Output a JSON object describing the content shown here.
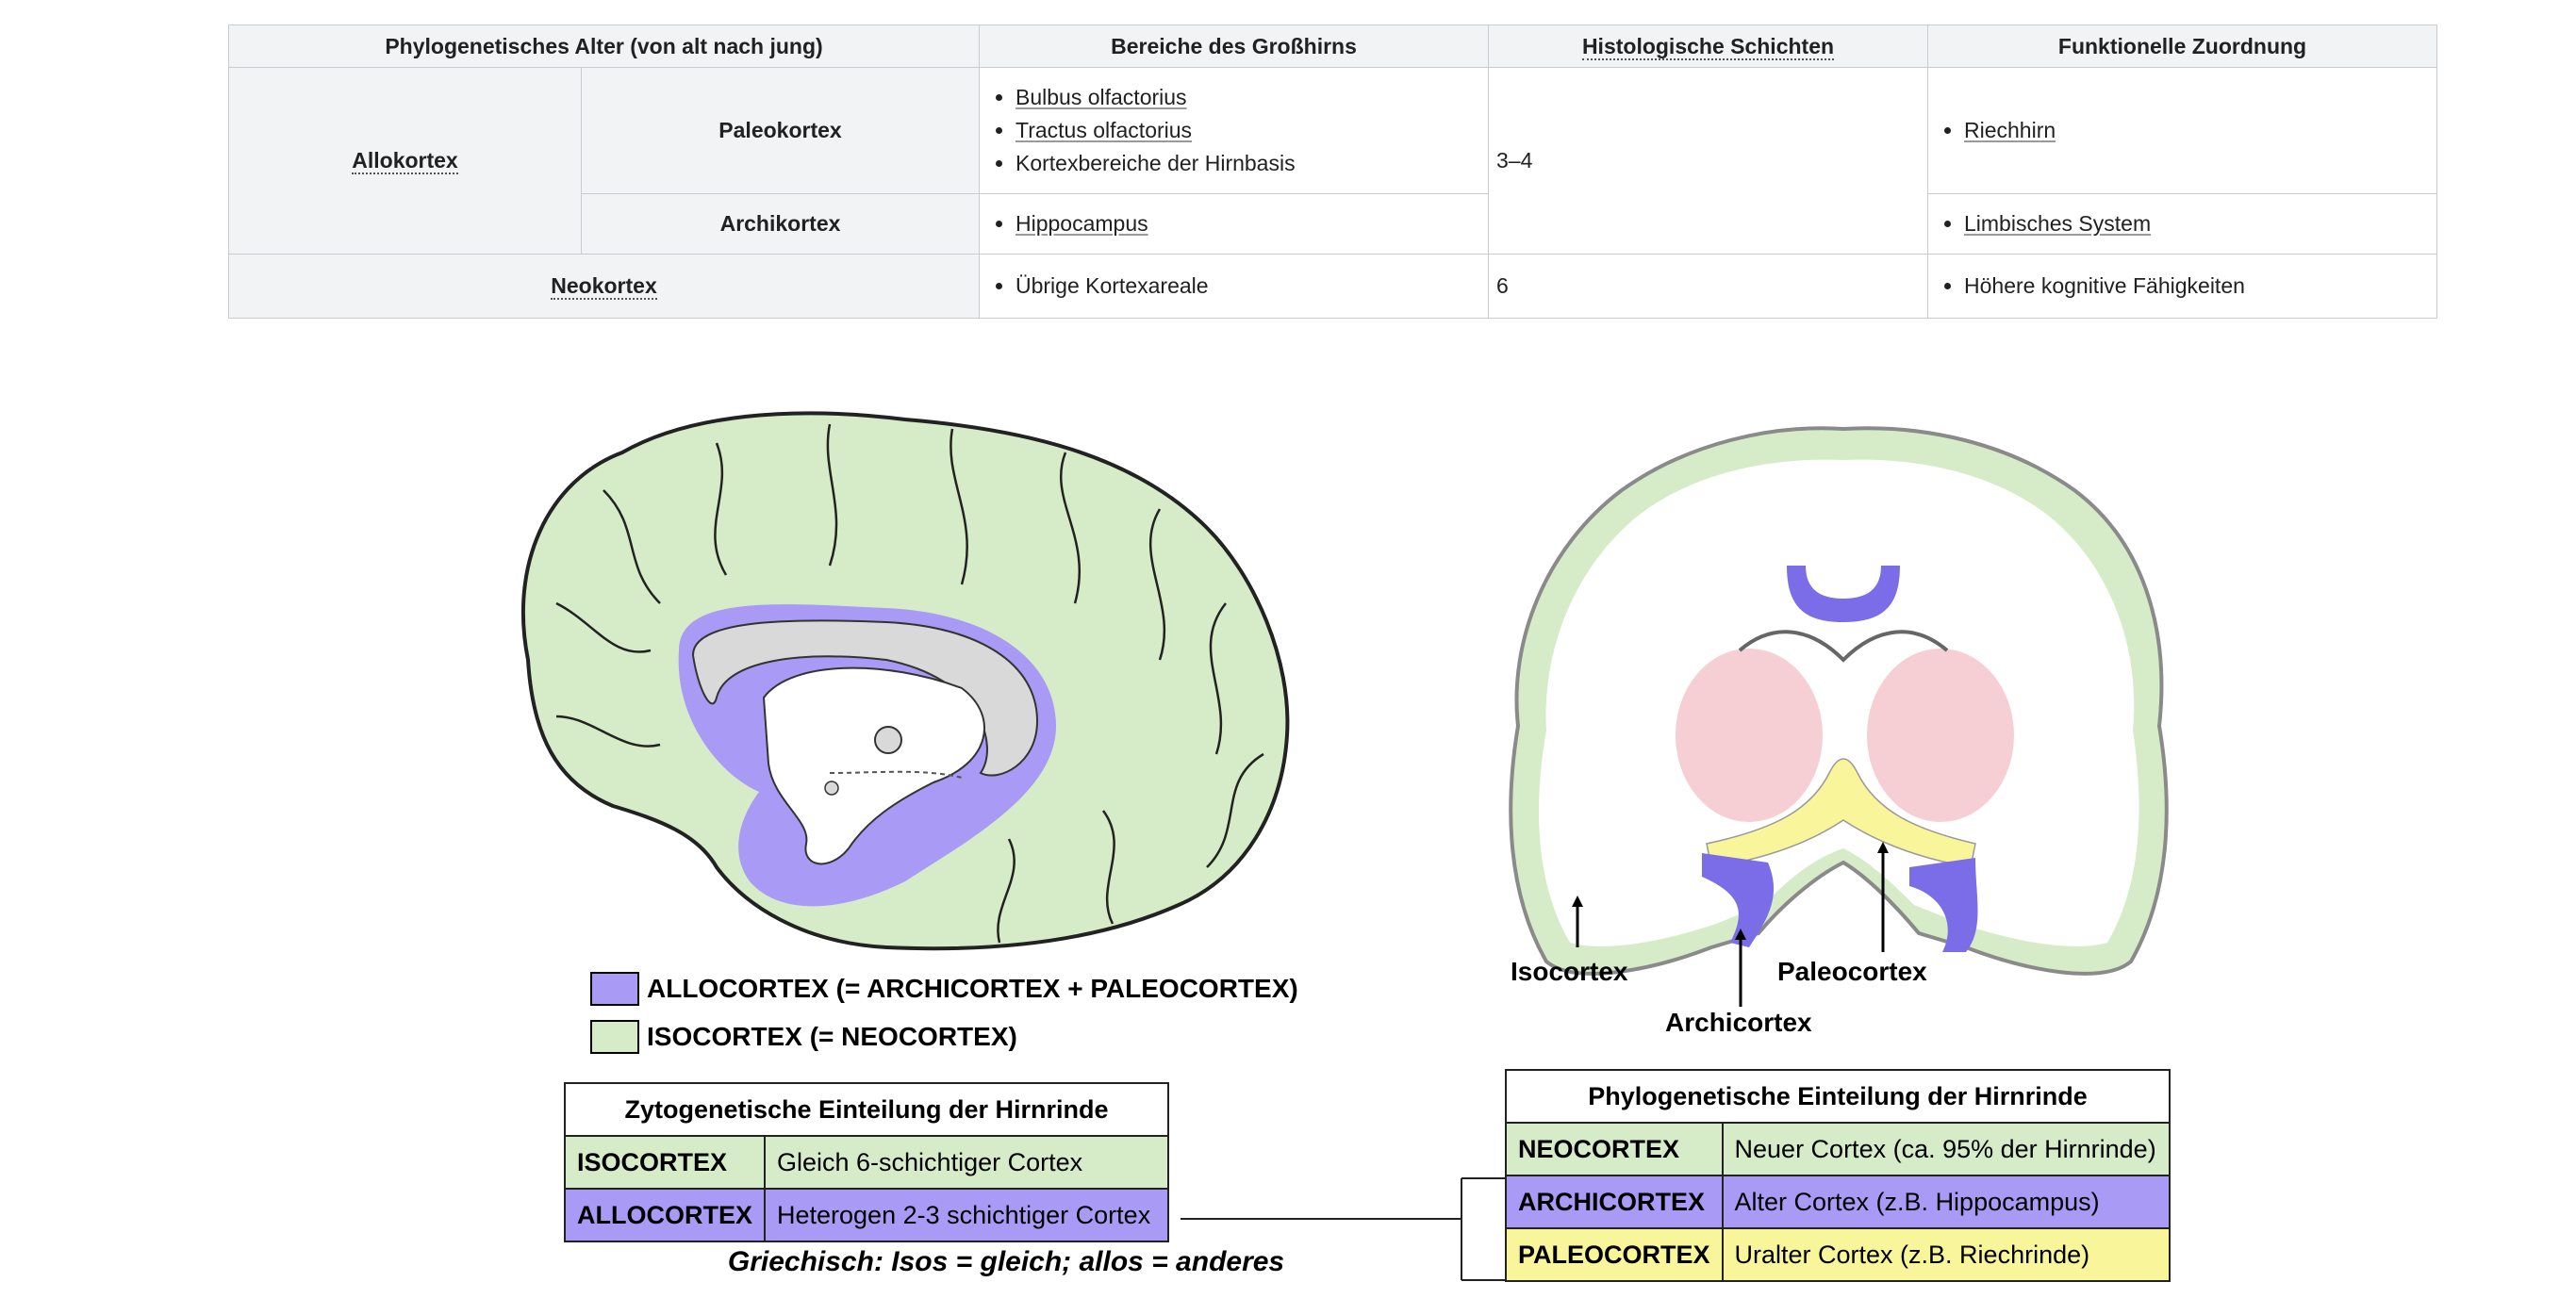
{
  "table": {
    "headers": [
      "Phylogenetisches Alter (von alt nach jung)",
      "Bereiche des Großhirns",
      "Histologische Schichten",
      "Funktionelle Zuordnung"
    ],
    "allokortex": "Allokortex",
    "paleokortex": {
      "label": "Paleokortex",
      "bereiche": [
        "Bulbus olfactorius",
        "Tractus olfactorius",
        "Kortexbereiche der Hirnbasis"
      ],
      "funktion": "Riechhirn"
    },
    "archikortex": {
      "label": "Archikortex",
      "bereiche": [
        "Hippocampus"
      ],
      "funktion": "Limbisches System"
    },
    "allo_schichten": "3–4",
    "neokortex": {
      "label": "Neokortex",
      "bereiche": [
        "Übrige Kortexareale"
      ],
      "schichten": "6",
      "funktion": "Höhere kognitive Fähigkeiten"
    }
  },
  "figure": {
    "legend": {
      "allo": "ALLOCORTEX (= ARCHICORTEX + PALEOCORTEX)",
      "iso": "ISOCORTEX (= NEOCORTEX)"
    },
    "coronal_labels": {
      "isocortex": "Isocortex",
      "paleocortex": "Paleocortex",
      "archicortex": "Archicortex"
    },
    "zyto": {
      "title": "Zytogenetische Einteilung der Hirnrinde",
      "rows": [
        {
          "key": "ISOCORTEX",
          "value": "Gleich 6-schichtiger Cortex"
        },
        {
          "key": "ALLOCORTEX",
          "value": "Heterogen 2-3 schichtiger Cortex"
        }
      ],
      "note": "Griechisch: Isos = gleich; allos = anderes"
    },
    "phylo": {
      "title": "Phylogenetische Einteilung der Hirnrinde",
      "rows": [
        {
          "key": "NEOCORTEX",
          "value": "Neuer Cortex (ca. 95% der Hirnrinde)"
        },
        {
          "key": "ARCHICORTEX",
          "value": "Alter Cortex (z.B. Hippocampus)"
        },
        {
          "key": "PALEOCORTEX",
          "value": "Uralter Cortex (z.B. Riechrinde)"
        }
      ]
    },
    "colors": {
      "iso": "#d6ecc9",
      "allo": "#a99af5",
      "paleo": "#f8f59a",
      "basal": "#f6cfd4"
    }
  }
}
